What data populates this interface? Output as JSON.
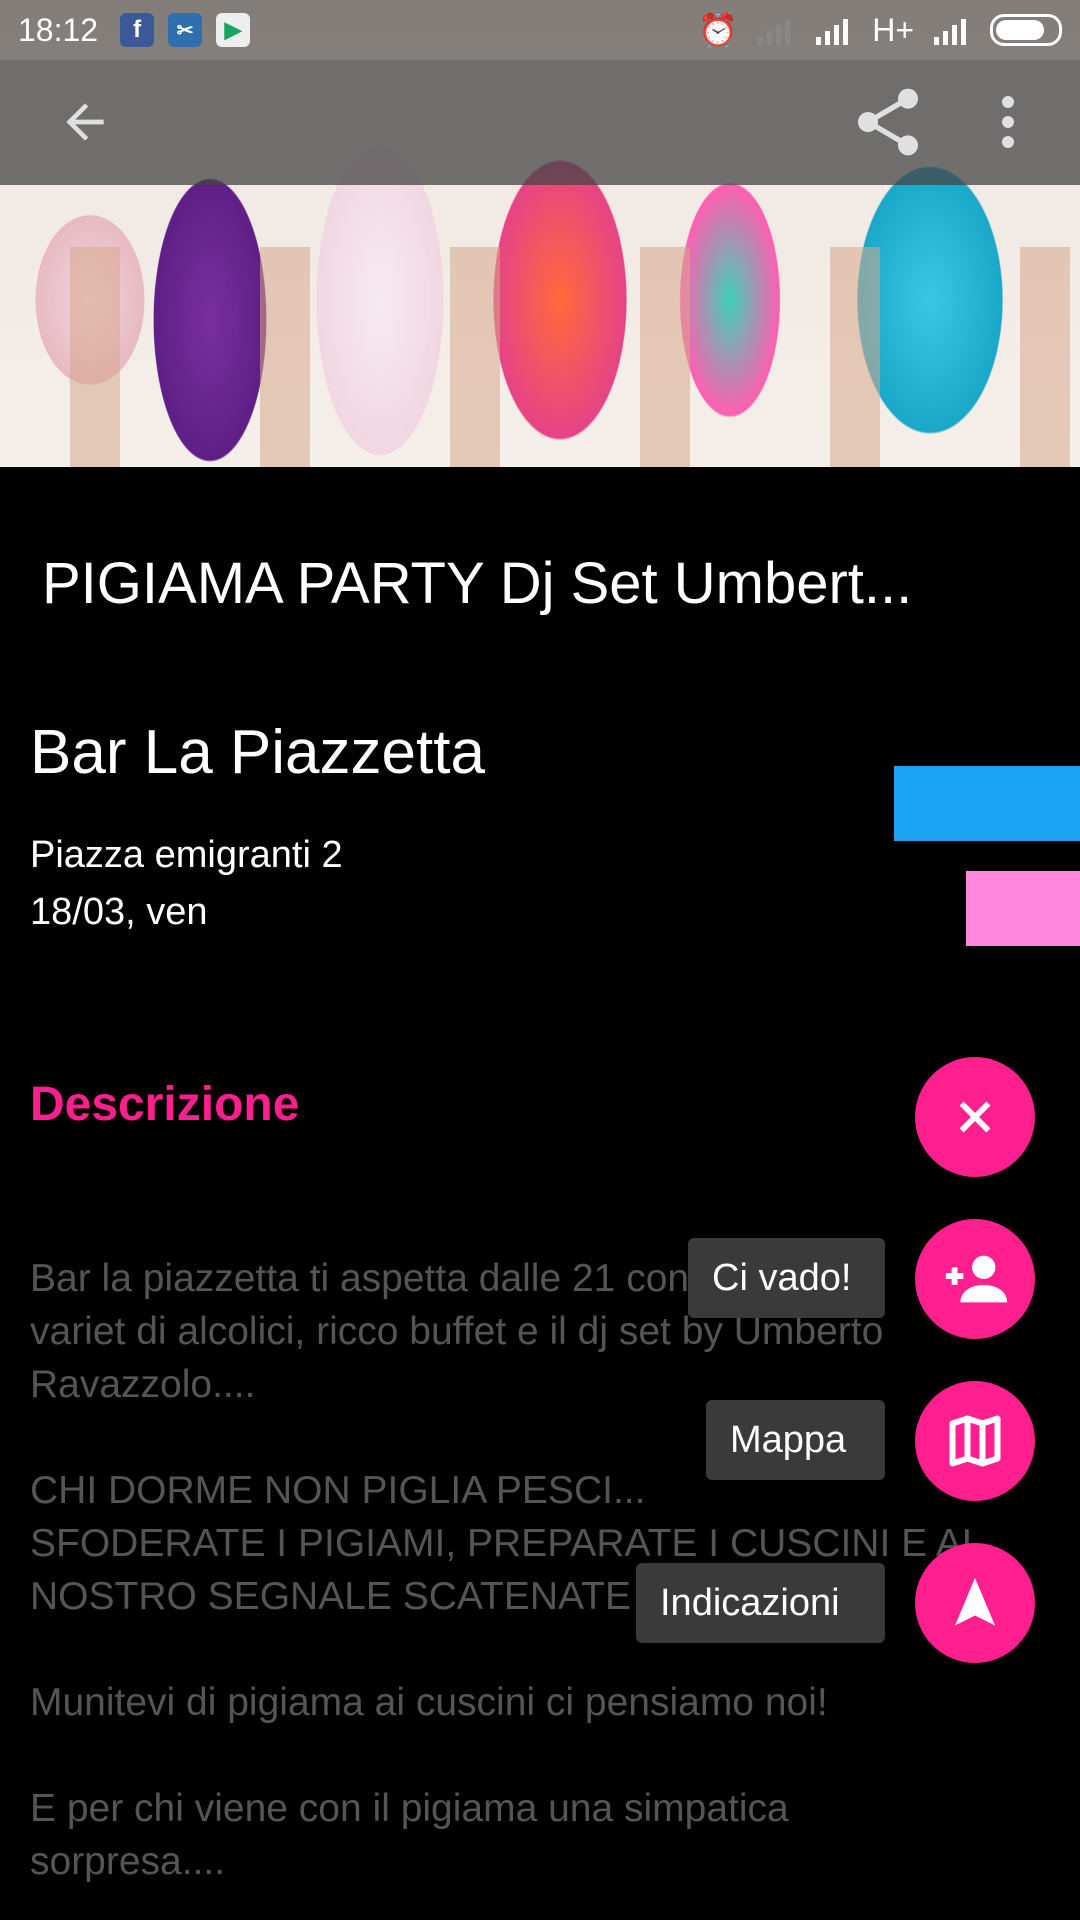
{
  "status_bar": {
    "time": "18:12",
    "network": "H+",
    "icons": [
      "facebook-icon",
      "app-icon",
      "play-store-icon",
      "alarm-icon",
      "signal-icon",
      "battery-icon"
    ]
  },
  "event": {
    "title": "PIGIAMA PARTY Dj Set Umbert...",
    "venue": "Bar La Piazzetta",
    "address": "Piazza emigranti 2",
    "date": "18/03, ven"
  },
  "description": {
    "heading": "Descrizione",
    "text": "Bar la piazzetta ti aspetta dalle 21 con\nvariet di alcolici, ricco buffet e il dj set by Umberto\nRavazzolo....\n\nCHI DORME NON PIGLIA PESCI...\nSFODERATE I PIGIAMI, PREPARATE I CUSCINI E AL\nNOSTRO SEGNALE SCATENATE L'INFERNO!\n\nMunitevi di pigiama ai cuscini ci pensiamo noi!\n\nE per chi viene con il pigiama una simpatica\nsorpresa...."
  },
  "fab_menu": {
    "go_label": "Ci vado!",
    "map_label": "Mappa",
    "directions_label": "Indicazioni"
  },
  "colors": {
    "accent": "#ff1f8e",
    "blue_tag": "#1aa3f3",
    "pink_tag": "#ff87dc"
  }
}
